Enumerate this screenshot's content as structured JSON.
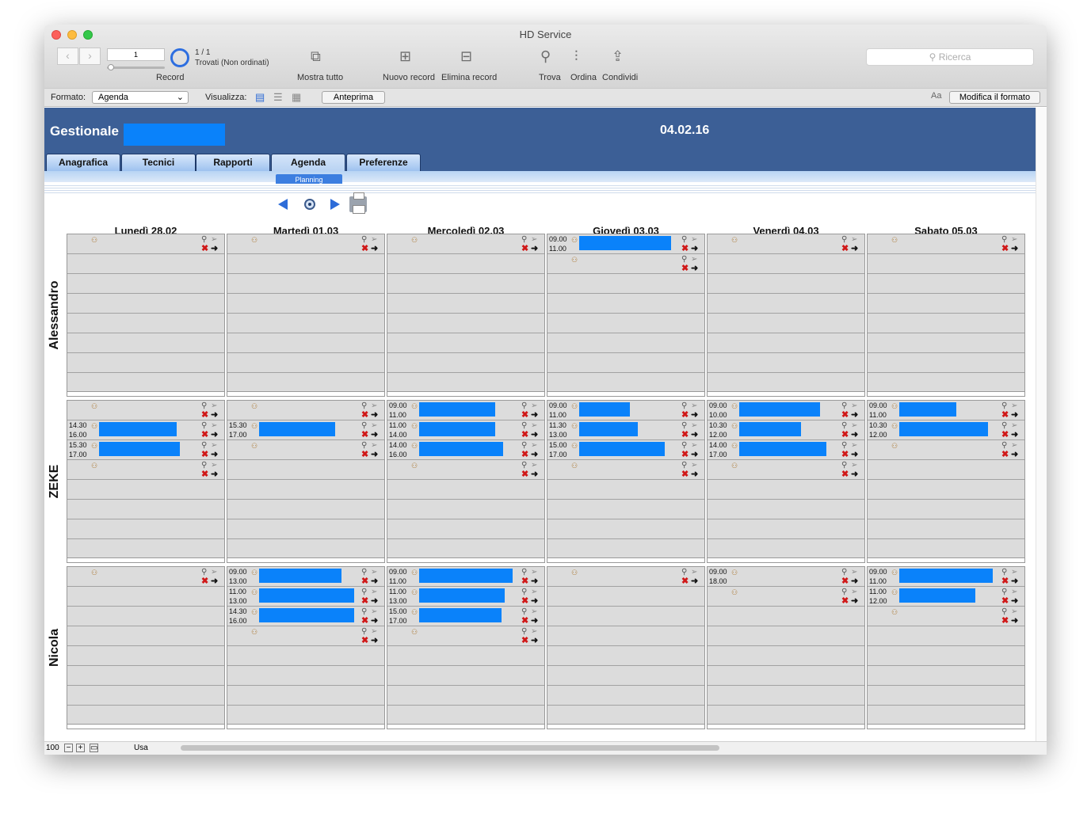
{
  "window": {
    "title": "HD Service"
  },
  "toolbar": {
    "record_number": "1",
    "record_count": "1 / 1",
    "found_status": "Trovati (Non ordinati)",
    "record_label": "Record",
    "show_all": "Mostra tutto",
    "new_record": "Nuovo record",
    "delete_record": "Elimina record",
    "find": "Trova",
    "sort": "Ordina",
    "share": "Condividi",
    "search_placeholder": "Ricerca"
  },
  "statusbar": {
    "format_label": "Formato:",
    "format_value": "Agenda",
    "view_label": "Visualizza:",
    "preview": "Anteprima",
    "font_icon": "Aa",
    "edit_layout": "Modifica il formato"
  },
  "header": {
    "title": "Gestionale",
    "date": "04.02.16"
  },
  "tabs": [
    "Anagrafica",
    "Tecnici",
    "Rapporti",
    "Agenda",
    "Preferenze"
  ],
  "subtab": "Planning",
  "days": [
    "Lunedì  28.02",
    "Martedì  01.03",
    "Mercoledì  02.03",
    "Giovedì  03.03",
    "Venerdì  04.03",
    "Sabato  05.03"
  ],
  "technicians": [
    "Alessandro",
    "ZEKE",
    "Nicola"
  ],
  "schedule": [
    [
      [
        {
          "t1": "",
          "t2": ""
        }
      ],
      [
        {
          "t1": "",
          "t2": ""
        }
      ],
      [
        {
          "t1": "",
          "t2": ""
        }
      ],
      [
        {
          "t1": "09.00",
          "t2": "11.00",
          "w": 116
        },
        {
          "t1": "",
          "t2": ""
        }
      ],
      [
        {
          "t1": "",
          "t2": ""
        }
      ],
      [
        {
          "t1": "",
          "t2": ""
        }
      ]
    ],
    [
      [
        {
          "t1": "",
          "t2": ""
        },
        {
          "t1": "14.30",
          "t2": "16.00",
          "w": 98
        },
        {
          "t1": "15.30",
          "t2": "17.00",
          "w": 102
        },
        {
          "t1": "",
          "t2": ""
        }
      ],
      [
        {
          "t1": "",
          "t2": ""
        },
        {
          "t1": "15.30",
          "t2": "17.00",
          "w": 96
        },
        {
          "t1": "",
          "t2": ""
        }
      ],
      [
        {
          "t1": "09.00",
          "t2": "11.00",
          "w": 96
        },
        {
          "t1": "11.00",
          "t2": "14.00",
          "w": 96
        },
        {
          "t1": "14.00",
          "t2": "16.00",
          "w": 106
        },
        {
          "t1": "",
          "t2": ""
        }
      ],
      [
        {
          "t1": "09.00",
          "t2": "11.00",
          "w": 64
        },
        {
          "t1": "11.30",
          "t2": "13.00",
          "w": 74
        },
        {
          "t1": "15.00",
          "t2": "17.00",
          "w": 108
        },
        {
          "t1": "",
          "t2": ""
        }
      ],
      [
        {
          "t1": "09.00",
          "t2": "10.00",
          "w": 102
        },
        {
          "t1": "10.30",
          "t2": "12.00",
          "w": 78
        },
        {
          "t1": "14.00",
          "t2": "17.00",
          "w": 110
        },
        {
          "t1": "",
          "t2": ""
        }
      ],
      [
        {
          "t1": "09.00",
          "t2": "11.00",
          "w": 72
        },
        {
          "t1": "10.30",
          "t2": "12.00",
          "w": 112
        },
        {
          "t1": "",
          "t2": ""
        }
      ]
    ],
    [
      [
        {
          "t1": "",
          "t2": ""
        }
      ],
      [
        {
          "t1": "09.00",
          "t2": "13.00",
          "w": 104
        },
        {
          "t1": "11.00",
          "t2": "13.00",
          "w": 120
        },
        {
          "t1": "14.30",
          "t2": "16.00",
          "w": 120
        },
        {
          "t1": "",
          "t2": ""
        }
      ],
      [
        {
          "t1": "09.00",
          "t2": "11.00",
          "w": 118
        },
        {
          "t1": "11.00",
          "t2": "13.00",
          "w": 108
        },
        {
          "t1": "15.00",
          "t2": "17.00",
          "w": 104
        },
        {
          "t1": "",
          "t2": ""
        }
      ],
      [
        {
          "t1": "",
          "t2": ""
        }
      ],
      [
        {
          "t1": "09.00",
          "t2": "18.00"
        },
        {
          "t1": "",
          "t2": ""
        }
      ],
      [
        {
          "t1": "09.00",
          "t2": "11.00",
          "w": 118
        },
        {
          "t1": "11.00",
          "t2": "12.00",
          "w": 96
        },
        {
          "t1": "",
          "t2": ""
        }
      ]
    ]
  ],
  "bottombar": {
    "zoom": "100",
    "mode": "Usa"
  }
}
